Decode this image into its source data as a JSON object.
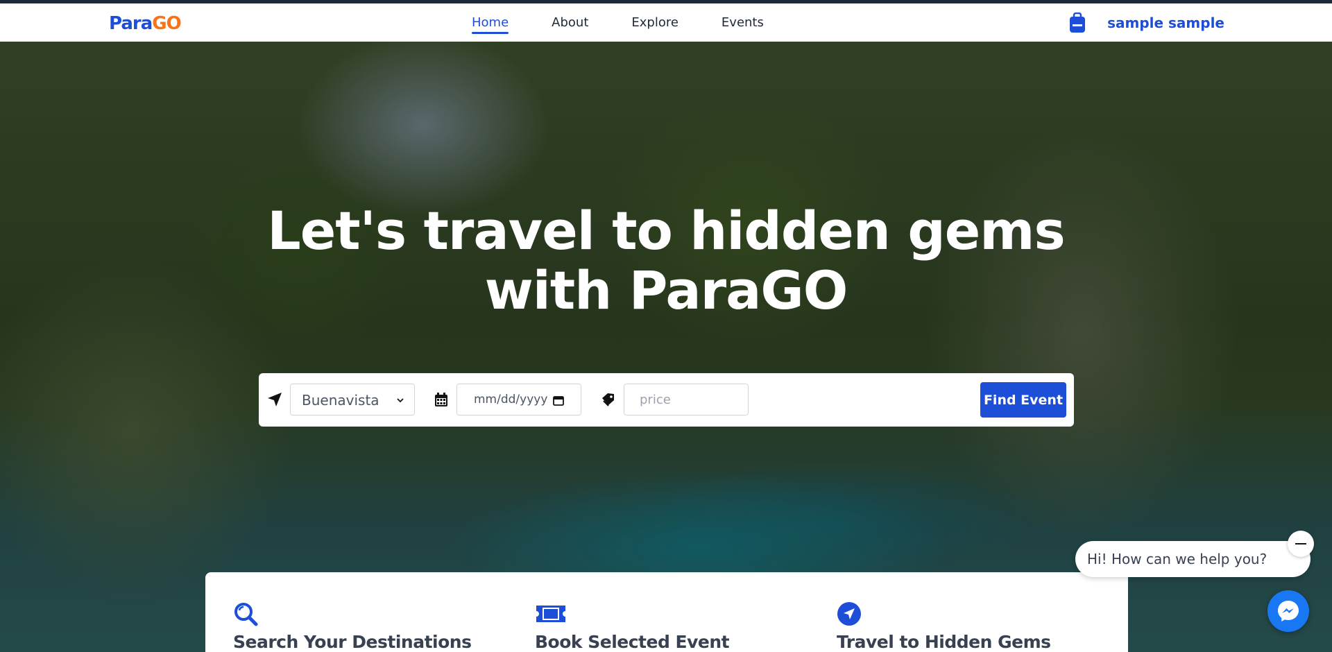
{
  "brand": {
    "logo_part1": "Para",
    "logo_part2": "GO"
  },
  "nav": {
    "items": [
      {
        "label": "Home",
        "active": true
      },
      {
        "label": "About",
        "active": false
      },
      {
        "label": "Explore",
        "active": false
      },
      {
        "label": "Events",
        "active": false
      }
    ]
  },
  "user": {
    "name": "sample sample",
    "icon": "backpack-icon"
  },
  "hero": {
    "title_line1": "Let's travel to hidden gems",
    "title_line2": "with ParaGO"
  },
  "search": {
    "location_value": "Buenavista",
    "date_placeholder": "mm/dd/yyyy",
    "price_placeholder": "price",
    "find_label": "Find Event"
  },
  "features": [
    {
      "title": "Search Your Destinations",
      "icon": "search-icon"
    },
    {
      "title": "Book Selected Event",
      "icon": "ticket-icon"
    },
    {
      "title": "Travel to Hidden Gems",
      "icon": "navigation-icon"
    }
  ],
  "chat": {
    "greeting": "Hi! How can we help you?"
  },
  "colors": {
    "primary": "#1d4ed8",
    "logo_accent": "#f97316",
    "messenger": "#1877f2"
  }
}
